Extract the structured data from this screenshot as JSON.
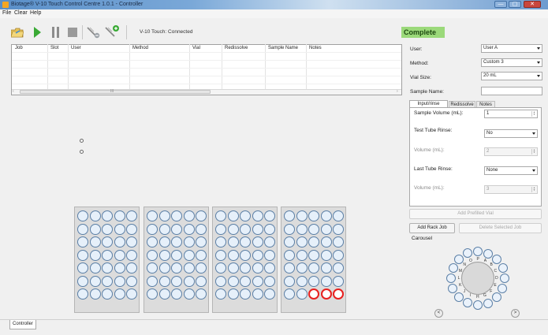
{
  "window": {
    "title": "Biotage® V-10 Touch Control Centre 1.0.1 - Controller",
    "minimize_glyph": "—",
    "maximize_glyph": "▢",
    "close_glyph": "✕"
  },
  "menu": [
    "File",
    "Clear",
    "Help"
  ],
  "toolbar": {
    "icons": [
      "open-folder-icon",
      "play-icon",
      "pause-icon",
      "stop-icon",
      "remove-job-icon",
      "add-job-icon"
    ],
    "connection_status": "V-10 Touch: Connected"
  },
  "run_status": "Complete",
  "job_table": {
    "columns": [
      "Job",
      "Slot",
      "User",
      "Method",
      "Vial",
      "Redissolve",
      "Sample Name",
      "Notes"
    ],
    "scroll_left": "‹",
    "scroll_right": "›",
    "scroll_grip": "III"
  },
  "form": {
    "user_label": "User:",
    "user_value": "User A",
    "method_label": "Method:",
    "method_value": "Custom 3",
    "vial_size_label": "Vial Size:",
    "vial_size_value": "20 mL",
    "sample_name_label": "Sample Name:",
    "sample_name_value": ""
  },
  "tabs": [
    "Input/rinse",
    "Redissolve",
    "Notes"
  ],
  "input_rinse": {
    "sample_volume_label": "Sample Volume (mL):",
    "sample_volume_value": "1",
    "test_tube_rinse_label": "Test Tube Rinse:",
    "test_tube_rinse_value": "No",
    "volume1_label": "Volume (mL):",
    "volume1_value": "2",
    "last_tube_rinse_label": "Last Tube Rinse:",
    "last_tube_rinse_value": "None",
    "volume2_label": "Volume (mL):",
    "volume2_value": "3"
  },
  "buttons": {
    "add_prefilled_vial": "Add Prefilled Vial",
    "add_rack_job": "Add Rack Job",
    "delete_selected_job": "Delete Selected Job"
  },
  "carousel": {
    "label": "Carousel",
    "slots": [
      "O",
      "P",
      "A",
      "B",
      "C",
      "D",
      "E",
      "F",
      "G",
      "H",
      "I",
      "J",
      "K",
      "L",
      "M",
      "N"
    ],
    "prev": "<",
    "next": ">"
  },
  "racks": {
    "count": 4,
    "rows": 7,
    "cols": 5,
    "selected_vials_rack4": [
      [
        6,
        2
      ],
      [
        6,
        3
      ],
      [
        6,
        4
      ]
    ]
  },
  "bottom_tab": "Controller"
}
